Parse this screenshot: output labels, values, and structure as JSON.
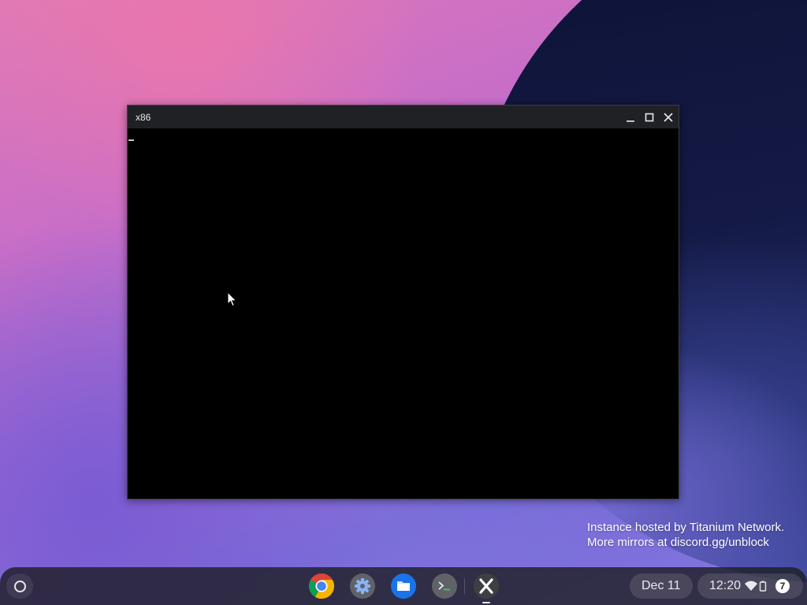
{
  "window": {
    "title": "x86",
    "controls": {
      "minimize_icon": "minimize-icon",
      "maximize_icon": "maximize-icon",
      "close_icon": "close-icon"
    }
  },
  "watermark": {
    "line1": "Instance hosted by Titanium Network.",
    "line2": "More mirrors at discord.gg/unblock"
  },
  "shelf": {
    "launcher_icon": "launcher-circle-icon",
    "apps": [
      {
        "name": "Chrome",
        "icon": "chrome-icon"
      },
      {
        "name": "Settings",
        "icon": "gear-icon"
      },
      {
        "name": "Files",
        "icon": "folder-icon"
      },
      {
        "name": "Terminal",
        "icon": "terminal-icon"
      },
      {
        "name": "x86",
        "icon": "x86-icon",
        "running": true
      }
    ],
    "date": "Dec 11",
    "time": "12:20",
    "notification_count": "7"
  },
  "colors": {
    "titlebar": "#202124",
    "terminal_bg": "#000000",
    "files_blue": "#1a73e8",
    "shelf_bg": "#1e1e26"
  }
}
